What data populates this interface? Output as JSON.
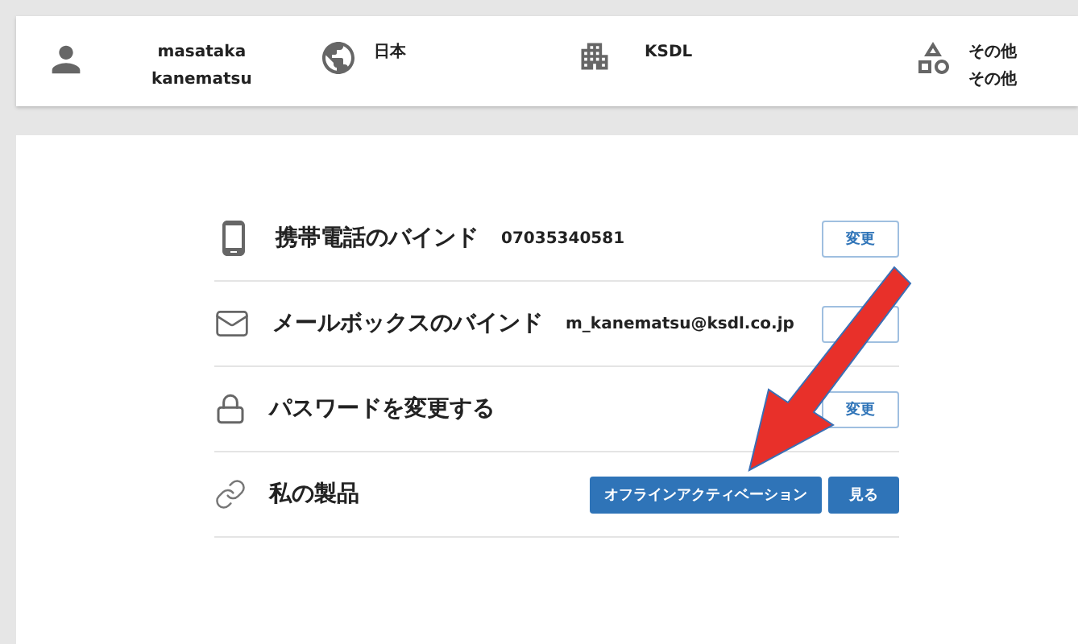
{
  "header": {
    "user": [
      "masataka",
      "kanematsu"
    ],
    "country": "日本",
    "company": "KSDL",
    "other": [
      "その他",
      "その他"
    ]
  },
  "rows": [
    {
      "kind": "phone",
      "label": "携帯電話のバインド",
      "value": "07035340581",
      "buttons": [
        {
          "label": "変更",
          "kind": "outline"
        }
      ]
    },
    {
      "kind": "mail",
      "label": "メールボックスのバインド",
      "value": "m_kanematsu@ksdl.co.jp",
      "buttons": [
        {
          "kind": "outline"
        }
      ]
    },
    {
      "kind": "lock",
      "label": "パスワードを変更する",
      "buttons": [
        {
          "label": "変更",
          "kind": "outline"
        }
      ]
    },
    {
      "kind": "link",
      "label": "私の製品",
      "buttons": [
        {
          "label": "オフラインアクティベーション",
          "kind": "filled"
        },
        {
          "label": "見る",
          "kind": "filled"
        }
      ]
    }
  ]
}
